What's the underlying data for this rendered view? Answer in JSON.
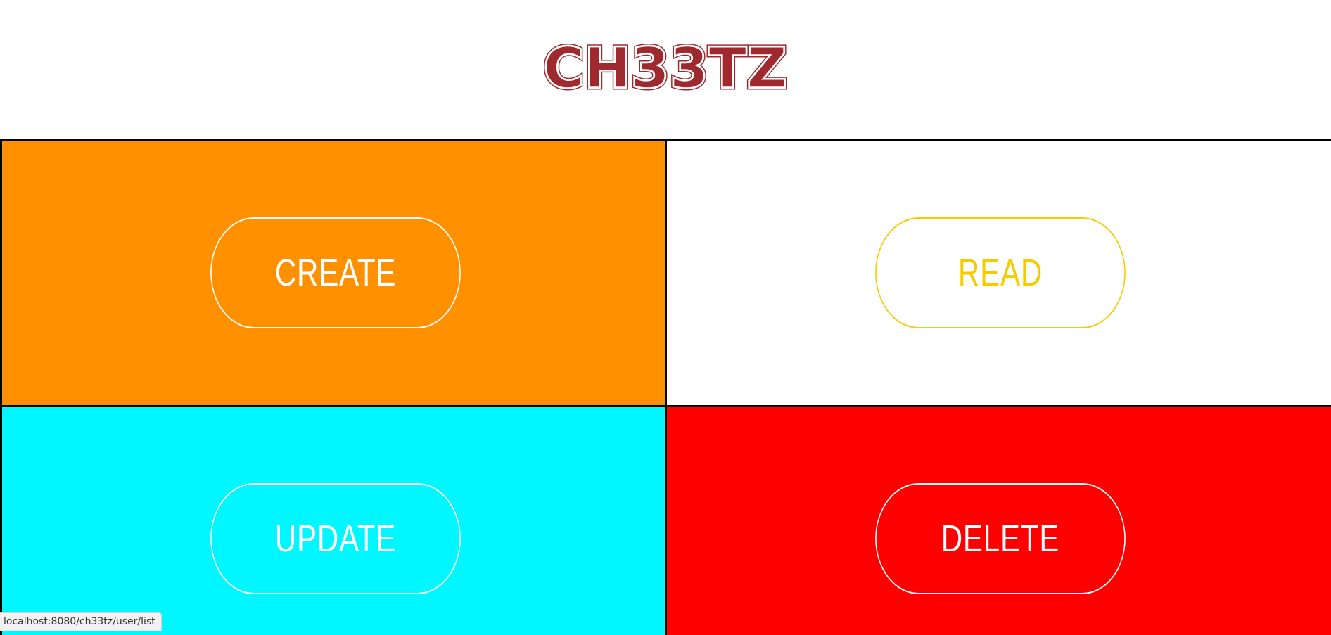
{
  "header": {
    "logo_text": "CH33TZ",
    "logo_color": "#9e2a2f"
  },
  "quadrants": [
    {
      "key": "create",
      "label": "CREATE",
      "background": "#ff9100",
      "text_color": "#ffffff",
      "border_color": "#ffffff"
    },
    {
      "key": "read",
      "label": "READ",
      "background": "#ffffff",
      "text_color": "#f5cc00",
      "border_color": "#f5cc00"
    },
    {
      "key": "update",
      "label": "UPDATE",
      "background": "#00f7ff",
      "text_color": "#ffffff",
      "border_color": "#ffffff"
    },
    {
      "key": "delete",
      "label": "DELETE",
      "background": "#ff0000",
      "text_color": "#ffffff",
      "border_color": "#ffffff"
    }
  ],
  "status_bar": {
    "url": "localhost:8080/ch33tz/user/list"
  }
}
